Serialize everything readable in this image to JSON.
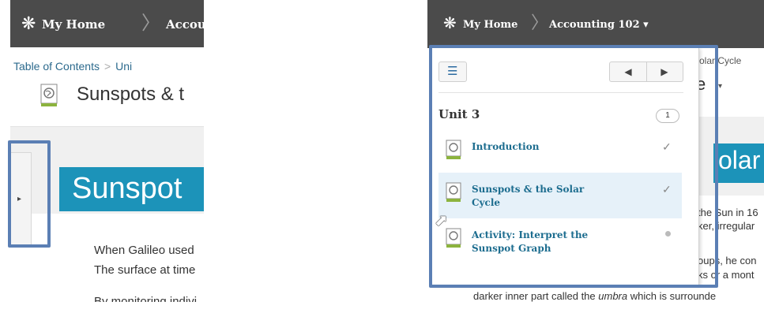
{
  "before": {
    "nav": {
      "home_label": "My Home",
      "course_label": "Accou"
    },
    "breadcrumb": {
      "toc": "Table of Contents",
      "unit": "Uni"
    },
    "page_title": "Sunspots & t",
    "banner_title": "Sunspot",
    "paragraph": [
      "When Galileo used",
      "The surface at time"
    ],
    "cut_line": "By monitoring indivi"
  },
  "after": {
    "nav": {
      "home_label": "My Home",
      "course_label": "Accounting 102 ▾"
    },
    "background": {
      "breadcrumb": "Solar Cycle",
      "title": "e",
      "banner": "olar",
      "lines": [
        "the Sun in 16",
        "ker, irregular",
        "oups, he con",
        "ks or a mont"
      ],
      "bottom_line_prefix": "darker inner part called the ",
      "bottom_line_em": "umbra",
      "bottom_line_suffix": " which is surrounde"
    },
    "toc": {
      "unit_title": "Unit 3",
      "count": "1",
      "items": [
        {
          "label": "Introduction",
          "status": "✓"
        },
        {
          "label": "Sunspots & the Solar Cycle",
          "status": "✓"
        },
        {
          "label": "Activity: Interpret the Sunspot Graph",
          "status": ""
        }
      ]
    }
  },
  "colors": {
    "topbar": "#4b4b4b",
    "banner": "#1c93b9",
    "link": "#1d6d8f",
    "highlight": "#5b7fb4"
  }
}
